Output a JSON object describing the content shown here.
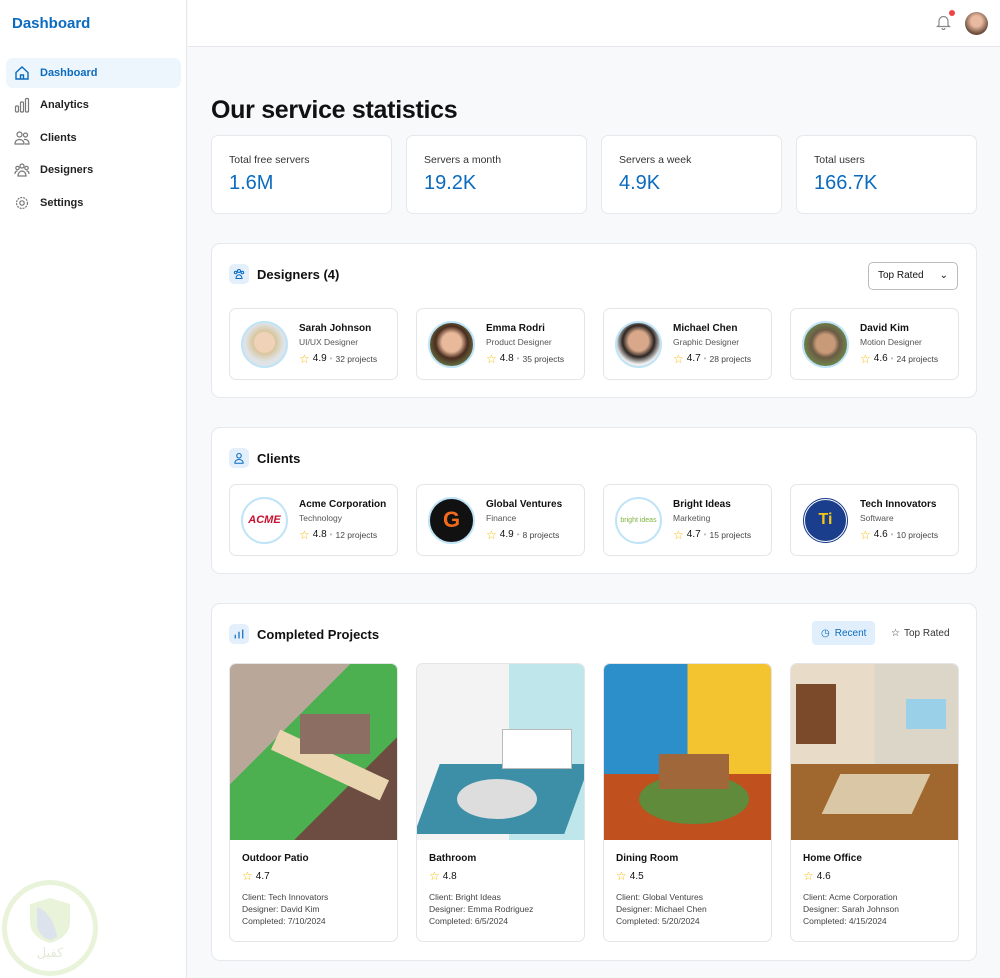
{
  "sidebar": {
    "brand": "Dashboard",
    "items": [
      {
        "label": "Dashboard",
        "icon": "home-icon"
      },
      {
        "label": "Analytics",
        "icon": "bar-chart-icon"
      },
      {
        "label": "Clients",
        "icon": "users-icon"
      },
      {
        "label": "Designers",
        "icon": "group-icon"
      },
      {
        "label": "Settings",
        "icon": "gear-icon"
      }
    ]
  },
  "header": {
    "notifications": true
  },
  "page_title": "Our service statistics",
  "stats": [
    {
      "label": "Total free servers",
      "value": "1.6M"
    },
    {
      "label": "Servers a month",
      "value": "19.2K"
    },
    {
      "label": "Servers a week",
      "value": "4.9K"
    },
    {
      "label": "Total users",
      "value": "166.7K"
    }
  ],
  "designers": {
    "title": "Designers (4)",
    "sort": "Top Rated",
    "items": [
      {
        "name": "Sarah Johnson",
        "role": "UI/UX Designer",
        "rating": "4.9",
        "projects": "32 projects"
      },
      {
        "name": "Emma Rodri",
        "role": "Product Designer",
        "rating": "4.8",
        "projects": "35 projects"
      },
      {
        "name": "Michael Chen",
        "role": "Graphic Designer",
        "rating": "4.7",
        "projects": "28 projects"
      },
      {
        "name": "David Kim",
        "role": "Motion Designer",
        "rating": "4.6",
        "projects": "24 projects"
      }
    ]
  },
  "clients": {
    "title": "Clients",
    "items": [
      {
        "name": "Acme Corporation",
        "industry": "Technology",
        "rating": "4.8",
        "projects": "12 projects",
        "logo": "ACME"
      },
      {
        "name": "Global Ventures",
        "industry": "Finance",
        "rating": "4.9",
        "projects": "8 projects",
        "logo": "G"
      },
      {
        "name": "Bright Ideas",
        "industry": "Marketing",
        "rating": "4.7",
        "projects": "15 projects",
        "logo": "bright ideas"
      },
      {
        "name": "Tech Innovators",
        "industry": "Software",
        "rating": "4.6",
        "projects": "10 projects",
        "logo": "Ti"
      }
    ]
  },
  "projects": {
    "title": "Completed Projects",
    "tabs": [
      "Recent",
      "Top Rated"
    ],
    "items": [
      {
        "title": "Outdoor Patio",
        "rating": "4.7",
        "client": "Client: Tech Innovators",
        "designer": "Designer: David Kim",
        "completed": "Completed: 7/10/2024"
      },
      {
        "title": "Bathroom",
        "rating": "4.8",
        "client": "Client: Bright Ideas",
        "designer": "Designer: Emma Rodriguez",
        "completed": "Completed: 6/5/2024"
      },
      {
        "title": "Dining Room",
        "rating": "4.5",
        "client": "Client: Global Ventures",
        "designer": "Designer: Michael Chen",
        "completed": "Completed: 5/20/2024"
      },
      {
        "title": "Home Office",
        "rating": "4.6",
        "client": "Client: Acme Corporation",
        "designer": "Designer: Sarah Johnson",
        "completed": "Completed: 4/15/2024"
      }
    ]
  },
  "watermark": "كفيل",
  "colors": {
    "accent": "#0b6bbf",
    "star": "#f5b800",
    "notification": "#ef4444"
  }
}
